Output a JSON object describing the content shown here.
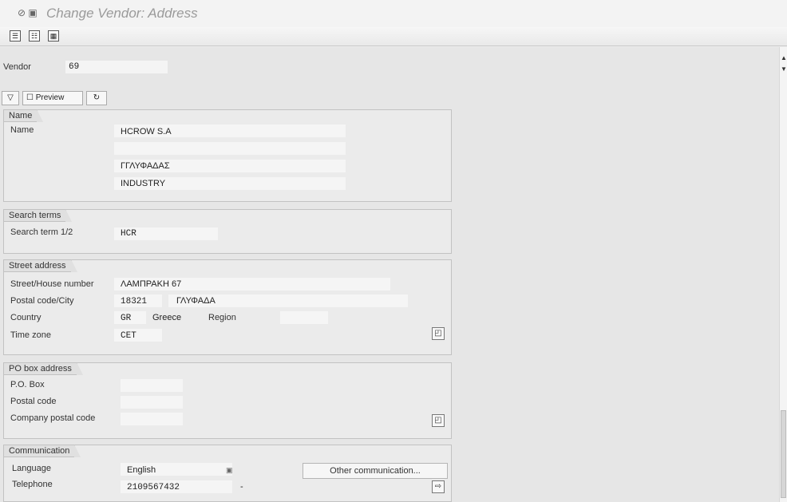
{
  "window": {
    "title": "Change Vendor: Address",
    "title_icons": "⊘ ▣"
  },
  "toolbar": {
    "buttons": [
      {
        "name": "display-change-icon",
        "glyph": "☰"
      },
      {
        "name": "copy-icon",
        "glyph": "☷"
      },
      {
        "name": "info-icon",
        "glyph": "▦"
      }
    ]
  },
  "vendor": {
    "label": "Vendor",
    "value": "69"
  },
  "actions": {
    "dropdown_glyph": "▽",
    "preview_label": "Preview",
    "preview_glyph": "☐",
    "extra_glyph": "↻"
  },
  "groups": {
    "name": {
      "title": "Name",
      "label": "Name",
      "line1": "HCROW S.A",
      "line2": "",
      "line3": "ΓΓΛΥΦΑΔΑΣ",
      "line4": "INDUSTRY"
    },
    "search": {
      "title": "Search terms",
      "label": "Search term 1/2",
      "value": "HCR"
    },
    "street": {
      "title": "Street address",
      "street_label": "Street/House number",
      "street_value": "ΛΑΜΠΡΑΚΗ 67",
      "postal_label": "Postal code/City",
      "postal_value": "18321",
      "city_value": "ΓΛΥΦΑΔΑ",
      "country_label": "Country",
      "country_code": "GR",
      "country_name": "Greece",
      "region_label": "Region",
      "timezone_label": "Time zone",
      "timezone_value": "CET",
      "more_glyph": "◰"
    },
    "pobox": {
      "title": "PO box address",
      "pobox_label": "P.O. Box",
      "postal_label": "Postal code",
      "company_postal_label": "Company postal code",
      "more_glyph": "◰"
    },
    "communication": {
      "title": "Communication",
      "language_label": "Language",
      "language_value": "English",
      "language_glyph": "▣",
      "other_comm_label": "Other communication...",
      "telephone_label": "Telephone",
      "telephone_value": "2109567432",
      "telephone_ext": "-",
      "telephone_glyph": "⇨"
    }
  }
}
